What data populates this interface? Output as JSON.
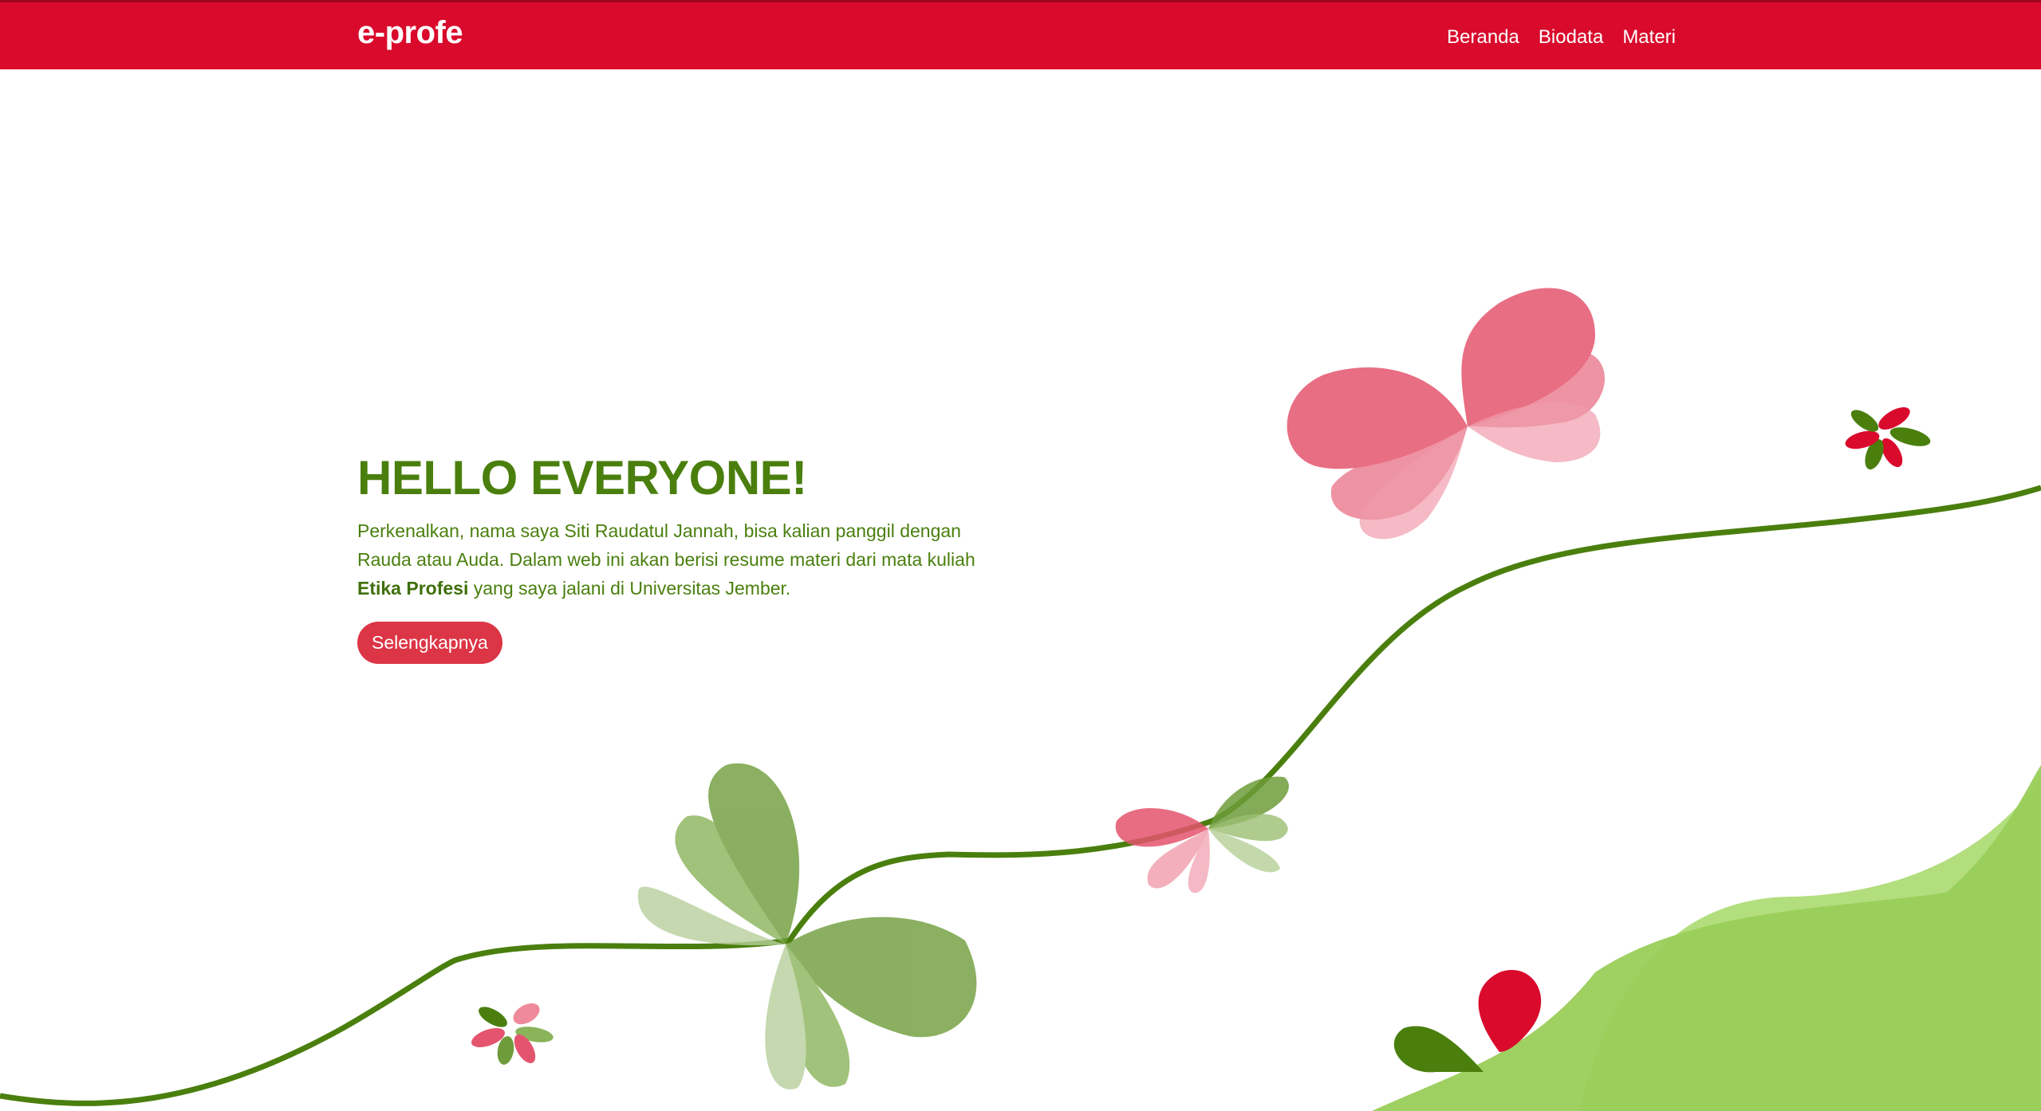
{
  "nav": {
    "brand": "e-profe",
    "links": [
      "Beranda",
      "Biodata",
      "Materi"
    ]
  },
  "hero": {
    "title": "HELLO EVERYONE!",
    "intro_before": "Perkenalkan, nama saya Siti Raudatul Jannah, bisa kalian panggil dengan Rauda atau Auda. Dalam web ini akan berisi resume materi dari mata kuliah ",
    "course": "Etika Profesi",
    "intro_after": " yang saya jalani di Universitas Jember.",
    "button": "Selengkapnya"
  },
  "colors": {
    "navbar": "#d90a2c",
    "accent_green": "#4a7f0e",
    "button": "#dc3545",
    "petal_red": "#e4546e",
    "leaf_green": "#6e9c3a",
    "hill_green": "#9acd5a"
  },
  "decorations": [
    "vine-line",
    "butterfly-red",
    "leaf-cluster-green",
    "small-flower",
    "hill"
  ]
}
